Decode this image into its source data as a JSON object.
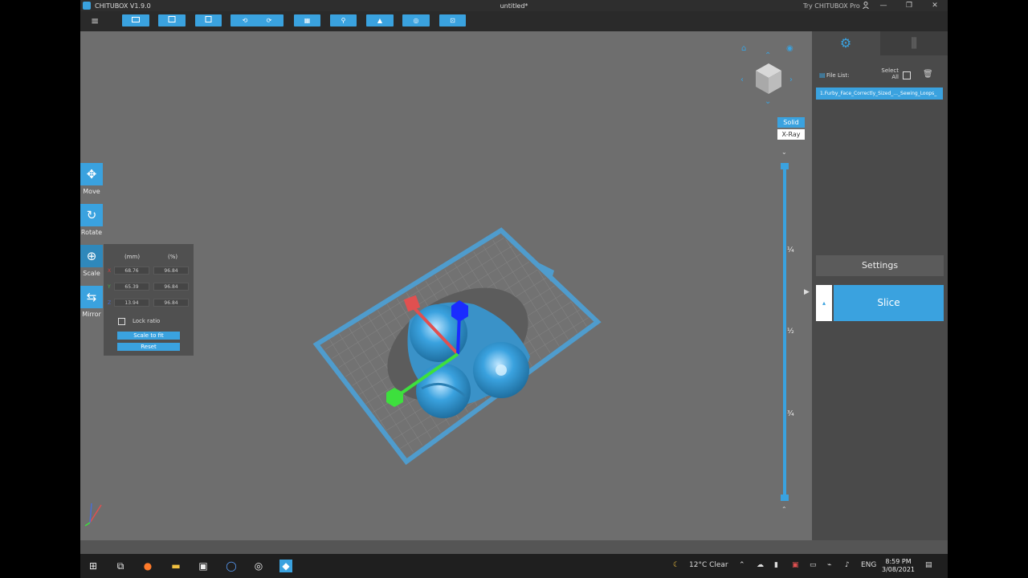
{
  "window": {
    "app_name": "CHITUBOX V1.9.0",
    "document_title": "untitled*",
    "promo": "Try CHITUBOX Pro",
    "controls": [
      "—",
      "❐",
      "✕"
    ]
  },
  "toolbar": {
    "menu_icon": "≡"
  },
  "left_tools": [
    {
      "label": "Move",
      "icon": "move-icon"
    },
    {
      "label": "Rotate",
      "icon": "rotate-icon"
    },
    {
      "label": "Scale",
      "icon": "scale-icon"
    },
    {
      "label": "Mirror",
      "icon": "mirror-icon"
    }
  ],
  "scale_panel": {
    "col_mm": "(mm)",
    "col_pct": "(%)",
    "rows": [
      {
        "axis": "X",
        "mm": "68.76",
        "pct": "96.84"
      },
      {
        "axis": "Y",
        "mm": "65.39",
        "pct": "96.84"
      },
      {
        "axis": "Z",
        "mm": "13.94",
        "pct": "96.84"
      }
    ],
    "lock_ratio": "Lock ratio",
    "scale_to_fit": "Scale to fit",
    "reset": "Reset"
  },
  "view_mode": {
    "solid": "Solid",
    "xray": "X-Ray"
  },
  "layer_slider": {
    "marks": [
      "¼",
      "½",
      "¾"
    ]
  },
  "right_panel": {
    "file_list_label": "File List:",
    "select_all": "Select All",
    "file": "1.Furby_Face_Correctly_Sized_..._Sewing_Loops_",
    "settings": "Settings",
    "slice": "Slice"
  },
  "taskbar": {
    "weather": "12°C  Clear",
    "lang": "ENG",
    "time": "8:59 PM",
    "date": "3/08/2021"
  },
  "colors": {
    "accent": "#3aa2df",
    "viewport": "#6e6e6e",
    "panel": "#4a4a4a"
  }
}
